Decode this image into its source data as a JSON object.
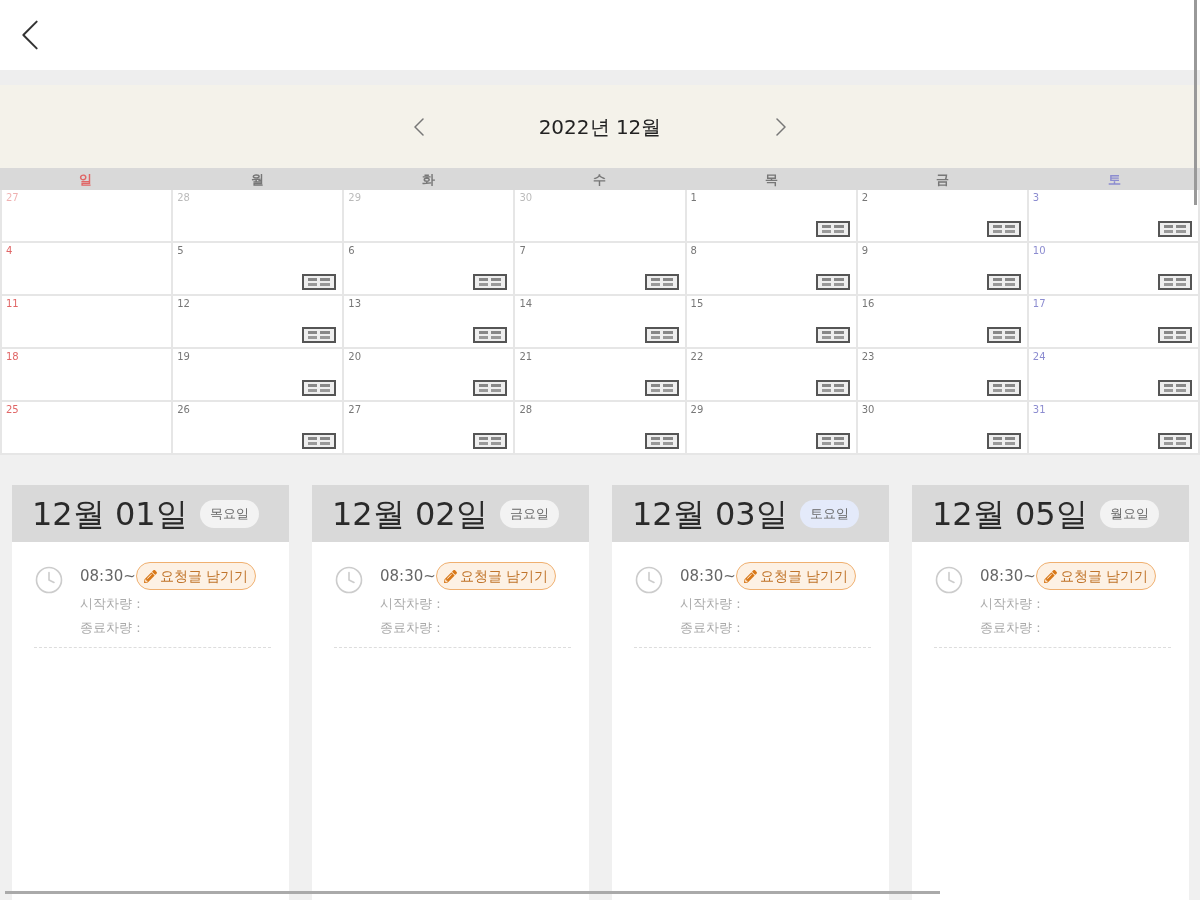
{
  "calendar": {
    "title": "2022년 12월",
    "day_names": [
      {
        "label": "일",
        "color": "#e06666"
      },
      {
        "label": "월",
        "color": "#777777"
      },
      {
        "label": "화",
        "color": "#777777"
      },
      {
        "label": "수",
        "color": "#777777"
      },
      {
        "label": "목",
        "color": "#777777"
      },
      {
        "label": "금",
        "color": "#777777"
      },
      {
        "label": "토",
        "color": "#8c8cd0"
      }
    ],
    "weeks": [
      [
        {
          "day": "27",
          "other_month": true,
          "tag": false
        },
        {
          "day": "28",
          "other_month": true,
          "tag": false
        },
        {
          "day": "29",
          "other_month": true,
          "tag": false
        },
        {
          "day": "30",
          "other_month": true,
          "tag": false
        },
        {
          "day": "1",
          "other_month": false,
          "tag": true
        },
        {
          "day": "2",
          "other_month": false,
          "tag": true
        },
        {
          "day": "3",
          "other_month": false,
          "tag": true
        }
      ],
      [
        {
          "day": "4",
          "other_month": false,
          "tag": false
        },
        {
          "day": "5",
          "other_month": false,
          "tag": true
        },
        {
          "day": "6",
          "other_month": false,
          "tag": true
        },
        {
          "day": "7",
          "other_month": false,
          "tag": true
        },
        {
          "day": "8",
          "other_month": false,
          "tag": true
        },
        {
          "day": "9",
          "other_month": false,
          "tag": true
        },
        {
          "day": "10",
          "other_month": false,
          "tag": true
        }
      ],
      [
        {
          "day": "11",
          "other_month": false,
          "tag": false
        },
        {
          "day": "12",
          "other_month": false,
          "tag": true
        },
        {
          "day": "13",
          "other_month": false,
          "tag": true
        },
        {
          "day": "14",
          "other_month": false,
          "tag": true
        },
        {
          "day": "15",
          "other_month": false,
          "tag": true
        },
        {
          "day": "16",
          "other_month": false,
          "tag": true
        },
        {
          "day": "17",
          "other_month": false,
          "tag": true
        }
      ],
      [
        {
          "day": "18",
          "other_month": false,
          "tag": false
        },
        {
          "day": "19",
          "other_month": false,
          "tag": true
        },
        {
          "day": "20",
          "other_month": false,
          "tag": true
        },
        {
          "day": "21",
          "other_month": false,
          "tag": true
        },
        {
          "day": "22",
          "other_month": false,
          "tag": true
        },
        {
          "day": "23",
          "other_month": false,
          "tag": true
        },
        {
          "day": "24",
          "other_month": false,
          "tag": true
        }
      ],
      [
        {
          "day": "25",
          "other_month": false,
          "tag": false
        },
        {
          "day": "26",
          "other_month": false,
          "tag": true
        },
        {
          "day": "27",
          "other_month": false,
          "tag": true
        },
        {
          "day": "28",
          "other_month": false,
          "tag": true
        },
        {
          "day": "29",
          "other_month": false,
          "tag": true
        },
        {
          "day": "30",
          "other_month": false,
          "tag": true
        },
        {
          "day": "31",
          "other_month": false,
          "tag": true
        }
      ]
    ]
  },
  "day_cards": [
    {
      "date": "12월 01일",
      "weekday": "목요일",
      "color": "#f3f3f3",
      "entries": [
        {
          "time": "08:30~",
          "action": "요청글 남기기",
          "start_label": "시작차량 :",
          "end_label": "종료차량 :"
        }
      ]
    },
    {
      "date": "12월 02일",
      "weekday": "금요일",
      "color": "#f3f3f3",
      "entries": [
        {
          "time": "08:30~",
          "action": "요청글 남기기",
          "start_label": "시작차량 :",
          "end_label": "종료차량 :"
        }
      ]
    },
    {
      "date": "12월 03일",
      "weekday": "토요일",
      "color": "#e4eafa",
      "entries": [
        {
          "time": "08:30~",
          "action": "요청글 남기기",
          "start_label": "시작차량 :",
          "end_label": "종료차량 :"
        }
      ]
    },
    {
      "date": "12월 05일",
      "weekday": "월요일",
      "color": "#f3f3f3",
      "entries": [
        {
          "time": "08:30~",
          "action": "요청글 남기기",
          "start_label": "시작차량 :",
          "end_label": "종료차량 :"
        }
      ]
    }
  ]
}
